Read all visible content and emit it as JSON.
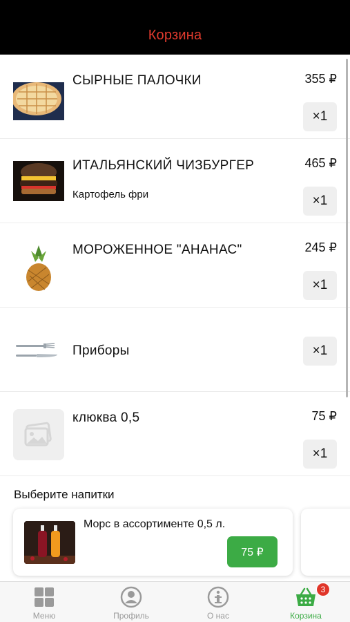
{
  "header": {
    "title": "Корзина"
  },
  "cart_items": [
    {
      "name": "СЫРНЫЕ ПАЛОЧКИ",
      "subtitle": "",
      "price": "355 ₽",
      "qty": "×1"
    },
    {
      "name": "ИТАЛЬЯНСКИЙ ЧИЗБУРГЕР",
      "subtitle": "Картофель фри",
      "price": "465 ₽",
      "qty": "×1"
    },
    {
      "name": "МОРОЖЕННОЕ \"АНАНАС\"",
      "subtitle": "",
      "price": "245 ₽",
      "qty": "×1"
    },
    {
      "name": "Приборы",
      "subtitle": "",
      "price": "",
      "qty": "×1"
    },
    {
      "name": "клюква 0,5",
      "subtitle": "",
      "price": "75 ₽",
      "qty": "×1"
    }
  ],
  "drinks": {
    "title": "Выберите напитки",
    "items": [
      {
        "name": "Морс в ассортименте 0,5 л.",
        "price": "75 ₽"
      }
    ]
  },
  "tabbar": {
    "items": [
      {
        "label": "Меню",
        "icon": "menu-grid-icon"
      },
      {
        "label": "Профиль",
        "icon": "profile-icon"
      },
      {
        "label": "О нас",
        "icon": "info-icon"
      },
      {
        "label": "Корзина",
        "icon": "basket-icon"
      }
    ],
    "active": "Корзина",
    "cart_badge": "3"
  },
  "colors": {
    "header_title": "#e23b2e",
    "accent_green": "#3cab45",
    "badge": "#e03529"
  }
}
